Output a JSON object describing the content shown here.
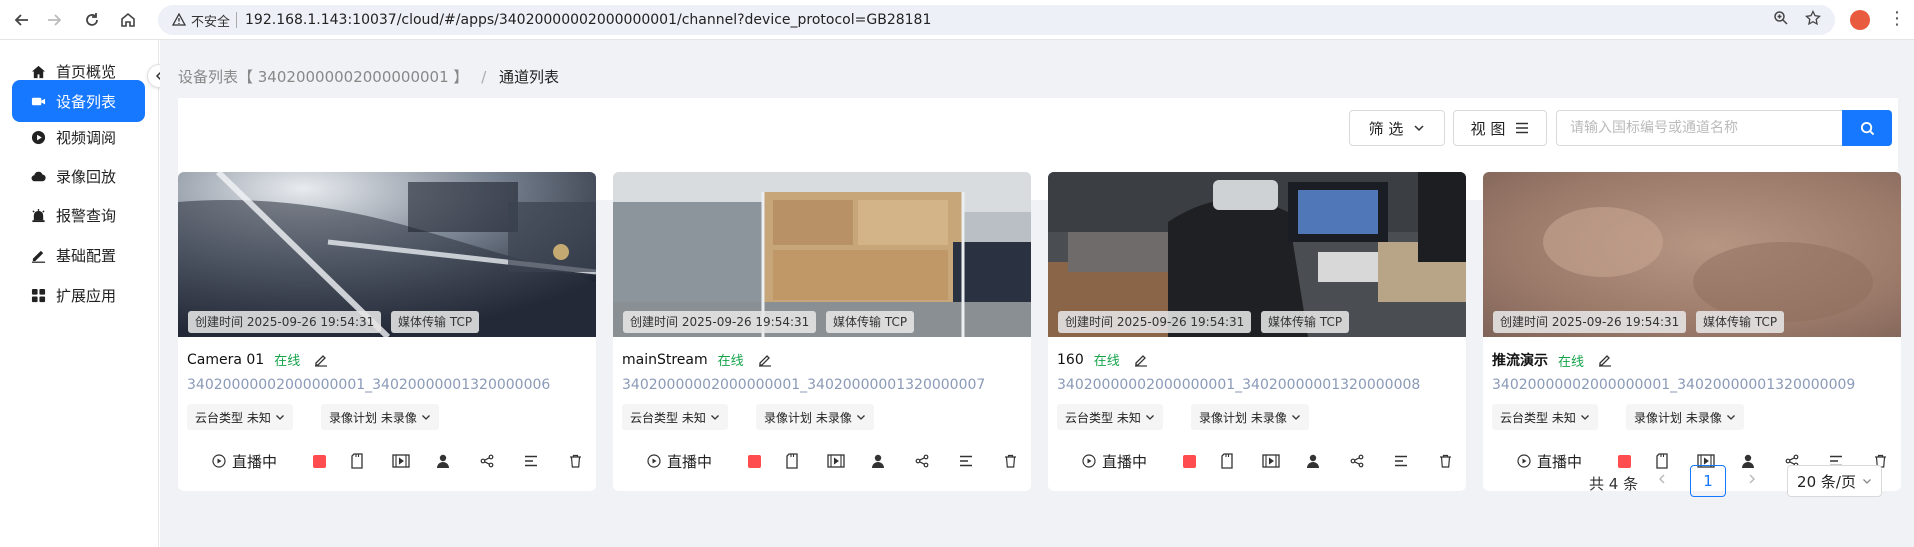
{
  "browser": {
    "security_label": "不安全",
    "url": "192.168.1.143:10037/cloud/#/apps/34020000002000000001/channel?device_protocol=GB28181"
  },
  "sidebar": {
    "items": [
      {
        "label": "首页概览",
        "icon": "home-icon"
      },
      {
        "label": "设备列表",
        "icon": "device-icon",
        "active": true
      },
      {
        "label": "视频调阅",
        "icon": "video-icon"
      },
      {
        "label": "录像回放",
        "icon": "cloud-icon"
      },
      {
        "label": "报警查询",
        "icon": "alarm-icon"
      },
      {
        "label": "基础配置",
        "icon": "edit-icon"
      },
      {
        "label": "扩展应用",
        "icon": "apps-icon"
      }
    ]
  },
  "breadcrumb": {
    "parent": "设备列表【 34020000002000000001 】",
    "separator": "/",
    "current": "通道列表"
  },
  "toolbar": {
    "filter_label": "筛 选",
    "view_label": "视 图",
    "search_placeholder": "请输入国标编号或通道名称"
  },
  "common": {
    "created_prefix": "创建时间",
    "media_prefix": "媒体传输",
    "ptz_label": "云台类型 未知",
    "record_label": "录像计划 未录像",
    "live_label": "直播中"
  },
  "channels": [
    {
      "name": "Camera 01",
      "status": "在线",
      "created": "2025-09-26 19:54:31",
      "transport": "TCP",
      "id": "34020000002000000001_34020000001320000006"
    },
    {
      "name": "mainStream",
      "status": "在线",
      "created": "2025-09-26 19:54:31",
      "transport": "TCP",
      "id": "34020000002000000001_34020000001320000007"
    },
    {
      "name": "160",
      "status": "在线",
      "created": "2025-09-26 19:54:31",
      "transport": "TCP",
      "id": "34020000002000000001_34020000001320000008"
    },
    {
      "name": "推流演示",
      "status": "在线",
      "created": "2025-09-26 19:54:31",
      "transport": "TCP",
      "id": "34020000002000000001_34020000001320000009"
    }
  ],
  "pagination": {
    "total": "共 4 条",
    "current_page": "1",
    "page_size": "20 条/页"
  },
  "colors": {
    "accent": "#1677ff",
    "online": "#15a34a",
    "stop": "#ff4d4f"
  }
}
